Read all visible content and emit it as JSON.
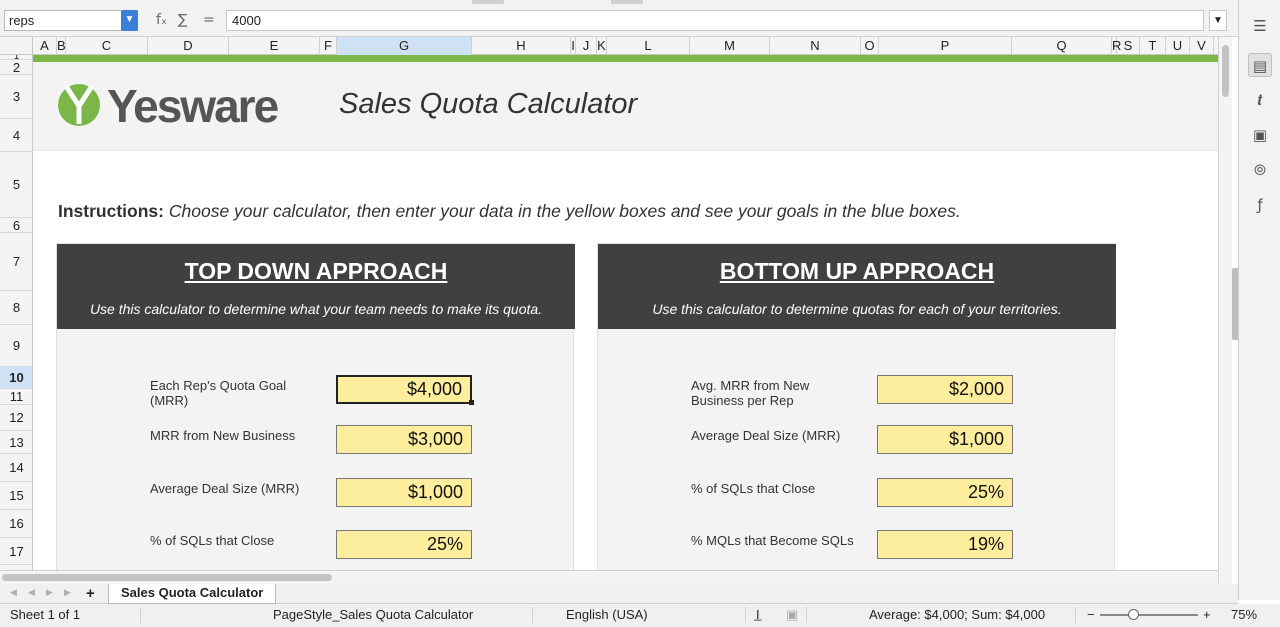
{
  "formula_bar": {
    "name_box": "reps",
    "formula": "4000",
    "fx_symbol": "fₓ",
    "sum_symbol": "∑",
    "equals_symbol": "="
  },
  "columns": [
    "A",
    "B",
    "C",
    "D",
    "E",
    "F",
    "G",
    "H",
    "I",
    "J",
    "K",
    "L",
    "M",
    "N",
    "O",
    "P",
    "Q",
    "R",
    "S",
    "T",
    "U",
    "V"
  ],
  "selected_column": "G",
  "rows": [
    "1",
    "2",
    "3",
    "4",
    "5",
    "6",
    "7",
    "8",
    "9",
    "10",
    "11",
    "12",
    "13",
    "14",
    "15",
    "16",
    "17"
  ],
  "selected_row": "10",
  "sheet": {
    "logo_text": "Yesware",
    "title": "Sales Quota Calculator",
    "instructions_label": "Instructions:",
    "instructions_text": "Choose your calculator, then enter your data in the yellow boxes and see your goals in the blue boxes.",
    "top_down": {
      "title": "TOP DOWN APPROACH",
      "subtitle": "Use this calculator to determine what your team needs to make its quota.",
      "fields": [
        {
          "label": "Each Rep's Quota Goal (MRR)",
          "value": "$4,000"
        },
        {
          "label": "MRR from New Business",
          "value": "$3,000"
        },
        {
          "label": "Average Deal Size (MRR)",
          "value": "$1,000"
        },
        {
          "label": "% of SQLs that Close",
          "value": "25%"
        }
      ]
    },
    "bottom_up": {
      "title": "BOTTOM UP APPROACH",
      "subtitle": "Use this calculator to determine quotas for each of your territories.",
      "fields": [
        {
          "label": "Avg. MRR from New Business per Rep",
          "value": "$2,000"
        },
        {
          "label": "Average Deal Size (MRR)",
          "value": "$1,000"
        },
        {
          "label": "% of SQLs that Close",
          "value": "25%"
        },
        {
          "label": "% MQLs that Become SQLs",
          "value": "19%"
        }
      ]
    }
  },
  "tabs": {
    "add_symbol": "+",
    "sheet_tab": "Sales Quota Calculator"
  },
  "status": {
    "sheet": "Sheet 1 of 1",
    "page_style": "PageStyle_Sales Quota Calculator",
    "language": "English (USA)",
    "summary": "Average: $4,000; Sum: $4,000",
    "zoom": "75%",
    "zoom_minus": "−",
    "zoom_plus": "+"
  },
  "colors": {
    "accent_green": "#7ab648",
    "panel_header": "#404040",
    "input_yellow": "#fdee9e",
    "selection_blue": "#cfe1f5"
  }
}
